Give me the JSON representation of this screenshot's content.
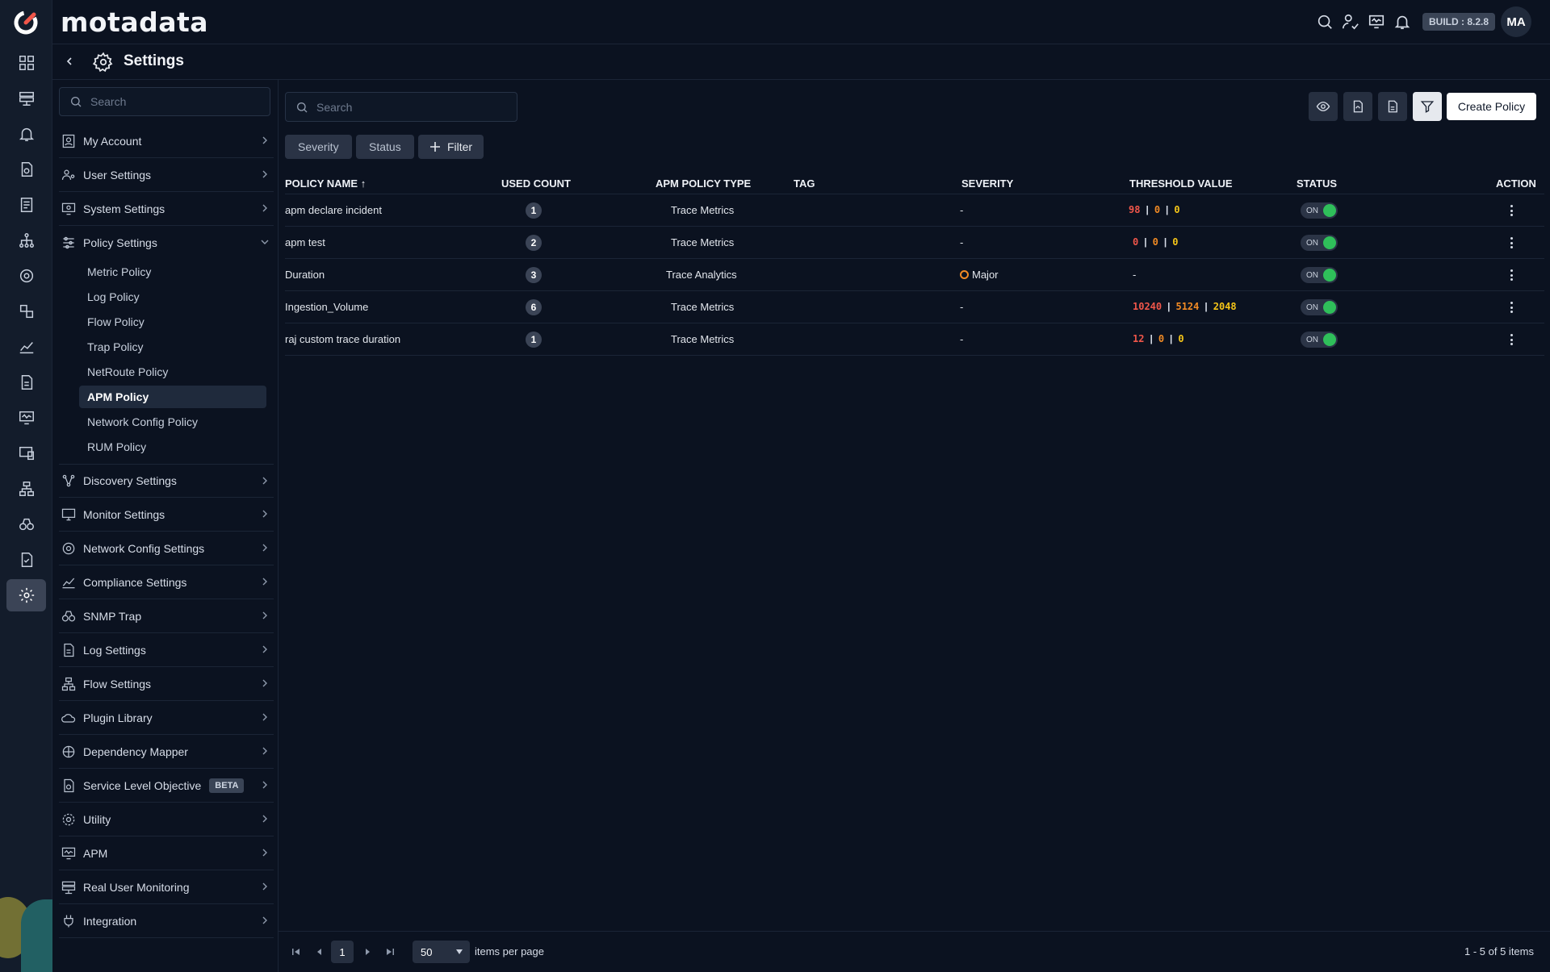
{
  "app": {
    "brand": "motadata",
    "build": "BUILD : 8.2.8",
    "avatar": "MA"
  },
  "colors": {
    "background": "#0b1220",
    "rail": "#131c2b",
    "active": "#3b4456",
    "critical": "#f0564a",
    "major": "#f08a24",
    "warning": "#f5c518",
    "on": "#2fbf5a"
  },
  "header": {
    "title": "Settings"
  },
  "sidebar": {
    "search_placeholder": "Search",
    "items": [
      {
        "label": "My Account",
        "icon": "user-card-icon"
      },
      {
        "label": "User Settings",
        "icon": "users-gear-icon"
      },
      {
        "label": "System Settings",
        "icon": "monitor-gear-icon"
      },
      {
        "label": "Policy Settings",
        "icon": "sliders-icon",
        "expanded": true
      },
      {
        "label": "Discovery Settings",
        "icon": "discovery-icon"
      },
      {
        "label": "Monitor Settings",
        "icon": "monitor-icon"
      },
      {
        "label": "Network Config Settings",
        "icon": "network-config-icon"
      },
      {
        "label": "Compliance Settings",
        "icon": "compliance-chart-icon"
      },
      {
        "label": "SNMP Trap",
        "icon": "binoculars-icon"
      },
      {
        "label": "Log Settings",
        "icon": "document-icon"
      },
      {
        "label": "Flow Settings",
        "icon": "flow-icon"
      },
      {
        "label": "Plugin Library",
        "icon": "cloud-icon"
      },
      {
        "label": "Dependency Mapper",
        "icon": "dependency-icon"
      },
      {
        "label": "Service Level Objective",
        "icon": "slo-icon",
        "badge": "BETA"
      },
      {
        "label": "Utility",
        "icon": "utility-gear-icon"
      },
      {
        "label": "APM",
        "icon": "apm-monitor-icon"
      },
      {
        "label": "Real User Monitoring",
        "icon": "rum-icon"
      },
      {
        "label": "Integration",
        "icon": "plug-icon"
      }
    ],
    "policy_sub": [
      "Metric Policy",
      "Log Policy",
      "Flow Policy",
      "Trap Policy",
      "NetRoute Policy",
      "APM Policy",
      "Network Config Policy",
      "RUM Policy"
    ],
    "active_sub": "APM Policy"
  },
  "toolbar": {
    "search_placeholder": "Search",
    "create_label": "Create Policy",
    "chips": [
      "Severity",
      "Status"
    ],
    "filter_label": "Filter"
  },
  "table": {
    "columns": [
      "POLICY NAME",
      "USED COUNT",
      "APM POLICY TYPE",
      "TAG",
      "SEVERITY",
      "THRESHOLD VALUE",
      "STATUS",
      "ACTION"
    ],
    "sort_indicator": "↑",
    "rows": [
      {
        "name": "apm declare incident",
        "count": "1",
        "type": "Trace Metrics",
        "tag": "",
        "severity": "-",
        "thresholds": [
          "98",
          "0",
          "0"
        ],
        "status": "ON"
      },
      {
        "name": "apm test",
        "count": "2",
        "type": "Trace Metrics",
        "tag": "",
        "severity": "-",
        "thresholds": [
          "0",
          "0",
          "0"
        ],
        "status": "ON"
      },
      {
        "name": "Duration",
        "count": "3",
        "type": "Trace Analytics",
        "tag": "",
        "severity": "Major",
        "thresholds": [
          "-"
        ],
        "status": "ON"
      },
      {
        "name": "Ingestion_Volume",
        "count": "6",
        "type": "Trace Metrics",
        "tag": "",
        "severity": "-",
        "thresholds": [
          "10240",
          "5124",
          "2048"
        ],
        "status": "ON"
      },
      {
        "name": "raj custom trace duration",
        "count": "1",
        "type": "Trace Metrics",
        "tag": "",
        "severity": "-",
        "thresholds": [
          "12",
          "0",
          "0"
        ],
        "status": "ON"
      }
    ]
  },
  "pagination": {
    "page": "1",
    "per_page": "50",
    "per_page_label": "items per page",
    "range": "1 - 5 of 5 items"
  }
}
